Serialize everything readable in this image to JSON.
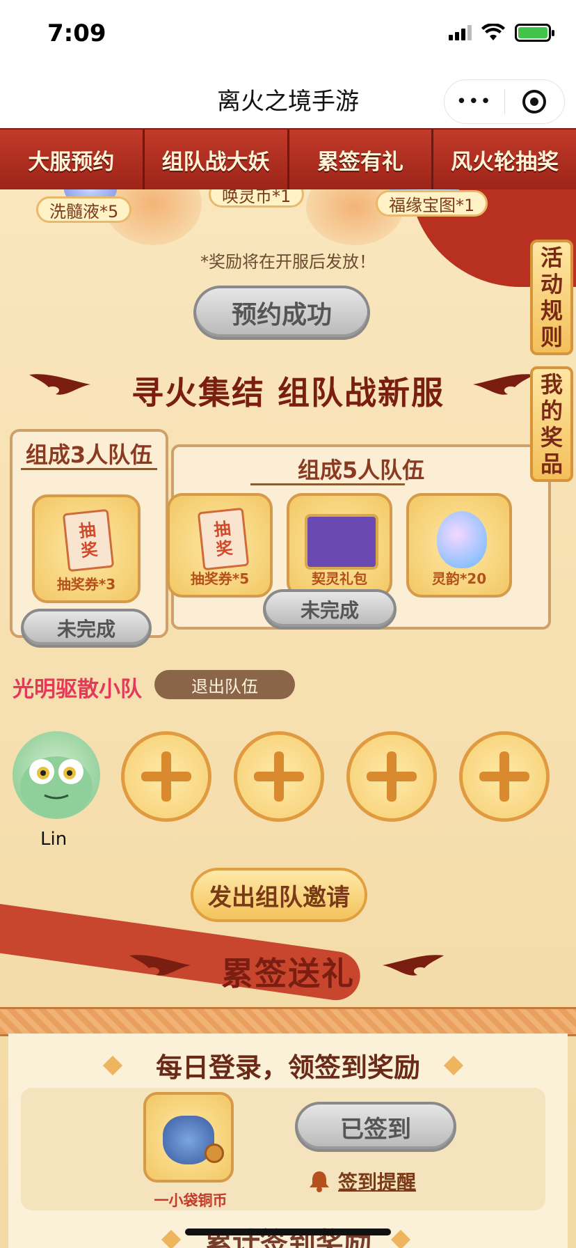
{
  "status_bar": {
    "time": "7:09"
  },
  "title_bar": {
    "title": "离火之境手游",
    "more_label": "•••"
  },
  "tabs": [
    {
      "label": "大服预约"
    },
    {
      "label": "组队战大妖"
    },
    {
      "label": "累签有礼"
    },
    {
      "label": "风火轮抽奖"
    }
  ],
  "preorder": {
    "rewards": [
      "洗髓液*5",
      "唤灵币*1",
      "福缘宝图*1"
    ],
    "notice": "*奖励将在开服后发放！",
    "button_label": "预约成功"
  },
  "team_section": {
    "title": "寻火集结 组队战新服",
    "team3": {
      "title": "组成3人队伍",
      "reward": {
        "label": "抽奖券*3",
        "ticket_text": [
          "抽",
          "奖"
        ]
      },
      "status": "未完成"
    },
    "team5": {
      "title": "组成5人队伍",
      "rewards": [
        {
          "label": "抽奖券*5",
          "ticket_text": [
            "抽",
            "奖"
          ]
        },
        {
          "label": "契灵礼包"
        },
        {
          "label": "灵韵*20"
        }
      ],
      "status": "未完成"
    },
    "team_name": "光明驱散小队",
    "leave_label": "退出队伍",
    "member_name": "Lin",
    "invite_label": "发出组队邀请"
  },
  "sign_section": {
    "title": "累签送礼",
    "daily_title": "每日登录，领签到奖励",
    "reward_label": "一小袋铜币",
    "signed_label": "已签到",
    "remind_label": "签到提醒",
    "next_title": "累计签到奖励"
  },
  "side_buttons": [
    {
      "label": "活动规则",
      "chars": [
        "活",
        "动",
        "规",
        "则"
      ]
    },
    {
      "label": "我的奖品",
      "chars": [
        "我",
        "的",
        "奖",
        "品"
      ]
    }
  ],
  "colors": {
    "tab_red": "#a82c22",
    "title_red": "#7a1e12",
    "team_name_pink": "#e23a58",
    "gold": "#f3c765"
  }
}
